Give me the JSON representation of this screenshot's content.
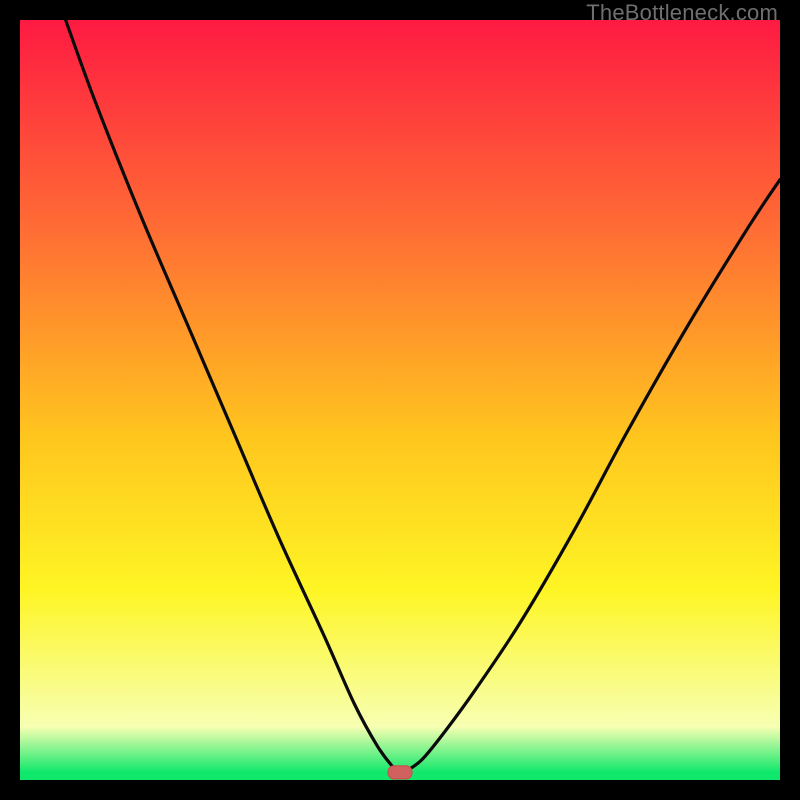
{
  "watermark": "TheBottleneck.com",
  "colors": {
    "frame": "#000000",
    "grad_top": "#fe1a42",
    "grad_mid1": "#ff6e34",
    "grad_mid2": "#ffc61e",
    "grad_mid3": "#fef524",
    "grad_low": "#f7ffb2",
    "grad_green": "#10e86b",
    "curve": "#0b0b0b",
    "marker_fill": "#d1615e",
    "marker_stroke": "#c9524f"
  },
  "chart_data": {
    "type": "line",
    "title": "",
    "xlabel": "",
    "ylabel": "",
    "xlim": [
      0,
      100
    ],
    "ylim": [
      0,
      100
    ],
    "note": "No axis ticks or numeric labels are rendered in the image; x/y values are estimated as percentages of the visible plot area.",
    "series": [
      {
        "name": "bottleneck-curve",
        "x": [
          6,
          10,
          16,
          22,
          28,
          34,
          40,
          44,
          47,
          49,
          50,
          51,
          53,
          56,
          60,
          66,
          73,
          80,
          88,
          96,
          100
        ],
        "y": [
          100,
          89,
          74,
          60,
          46,
          32,
          19,
          10,
          4.5,
          1.8,
          1.0,
          1.3,
          2.8,
          6.5,
          12,
          21,
          33,
          46,
          60,
          73,
          79
        ]
      }
    ],
    "marker": {
      "x": 50,
      "y": 1.0,
      "shape": "rounded-rect"
    }
  }
}
